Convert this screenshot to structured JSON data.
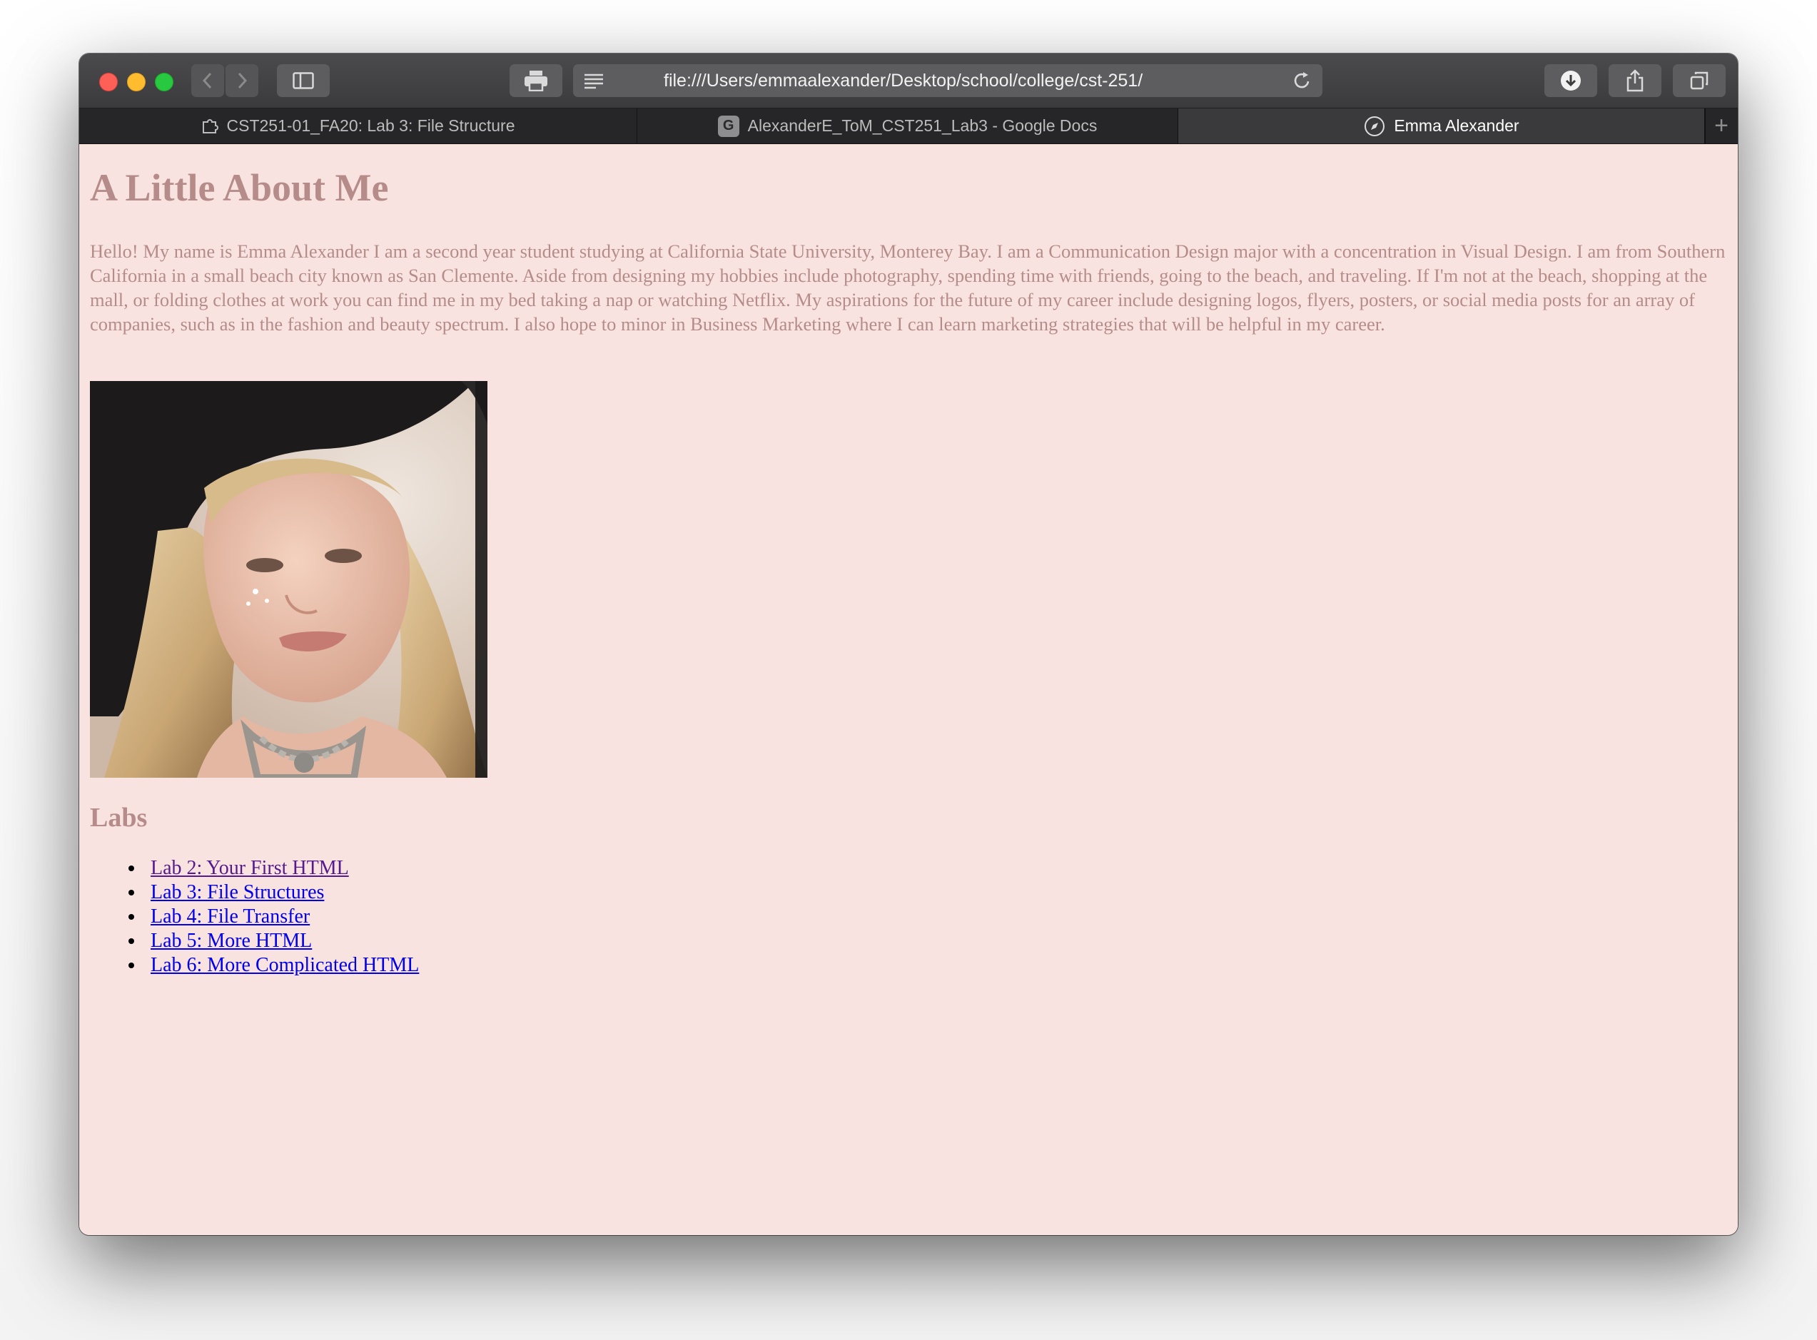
{
  "browser": {
    "url": "file:///Users/emmaalexander/Desktop/school/college/cst-251/",
    "tabs": [
      {
        "title": "CST251-01_FA20: Lab 3: File Structure",
        "icon": "puzzle-icon",
        "active": false
      },
      {
        "title": "AlexanderE_ToM_CST251_Lab3 - Google Docs",
        "icon": "g-badge-icon",
        "active": false
      },
      {
        "title": "Emma Alexander",
        "icon": "compass-icon",
        "active": true
      }
    ],
    "g_badge": "G",
    "new_tab": "+"
  },
  "page": {
    "heading": "A Little About Me",
    "bio": "Hello! My name is Emma Alexander I am a second year student studying at California State University, Monterey Bay. I am a Communication Design major with a concentration in Visual Design. I am from Southern California in a small beach city known as San Clemente. Aside from designing my hobbies include photography, spending time with friends, going to the beach, and traveling. If I'm not at the beach, shopping at the mall, or folding clothes at work you can find me in my bed taking a nap or watching Netflix. My aspirations for the future of my career include designing logos, flyers, posters, or social media posts for an array of companies, such as in the fashion and beauty spectrum. I also hope to minor in Business Marketing where I can learn marketing strategies that will be helpful in my career.",
    "labs_heading": "Labs",
    "labs": [
      {
        "label": "Lab 2: Your First HTML"
      },
      {
        "label": "Lab 3: File Structures"
      },
      {
        "label": "Lab 4: File Transfer"
      },
      {
        "label": "Lab 5: More HTML"
      },
      {
        "label": "Lab 6: More Complicated HTML"
      }
    ]
  },
  "colors": {
    "page_background": "#f9e3e1",
    "heading_text": "#b58c89",
    "link": "#0000ee",
    "visited_link": "#551a8b"
  }
}
